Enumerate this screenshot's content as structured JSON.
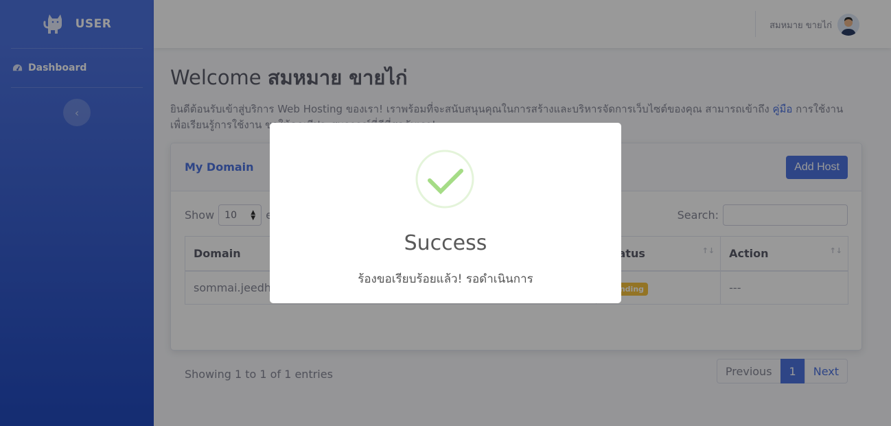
{
  "brand": {
    "name": "USER",
    "icon": "cat-icon"
  },
  "sidebar": {
    "items": [
      {
        "label": "Dashboard",
        "icon": "tachometer-icon"
      }
    ],
    "toggle_icon": "chevron-left-icon"
  },
  "topbar": {
    "user_name": "สมหมาย ขายไก่",
    "avatar_icon": "user-avatar"
  },
  "main": {
    "welcome_prefix": "Welcome",
    "welcome_name": "สมหมาย ขายไก่",
    "intro_before": "ยินดีต้อนรับเข้าสู่บริการ Web Hosting ของเรา! เราพร้อมที่จะสนับสนุนคุณในการสร้างและบริหารจัดการเว็บไซต์ของคุณ สามารถเข้าถึง",
    "intro_link": "คู่มือ",
    "intro_after": "การใช้งานเพื่อเรียนรู้การใช้งาน ขอให้คุณมีประสบการณ์ที่ดีที่สุดกับเรา!"
  },
  "domain_card": {
    "title": "My Domain",
    "add_button": "Add Host",
    "show_label": "Show",
    "entries_label": "entries",
    "length_value": "10",
    "search_label": "Search:",
    "columns": [
      "Domain",
      "Status",
      "Action"
    ],
    "rows": [
      {
        "domain": "sommai.jeedhost.com",
        "status": "Pending",
        "action": "---"
      }
    ],
    "info": "Showing 1 to 1 of 1 entries",
    "pagination": {
      "previous": "Previous",
      "current": "1",
      "next": "Next"
    }
  },
  "modal": {
    "icon": "success-check-icon",
    "title": "Success",
    "message": "ร้องขอเรียบร้อยแล้ว! รอดำเนินการ"
  },
  "colors": {
    "primary": "#4e73df",
    "warning": "#f6c23e",
    "success": "#a5dc86"
  }
}
